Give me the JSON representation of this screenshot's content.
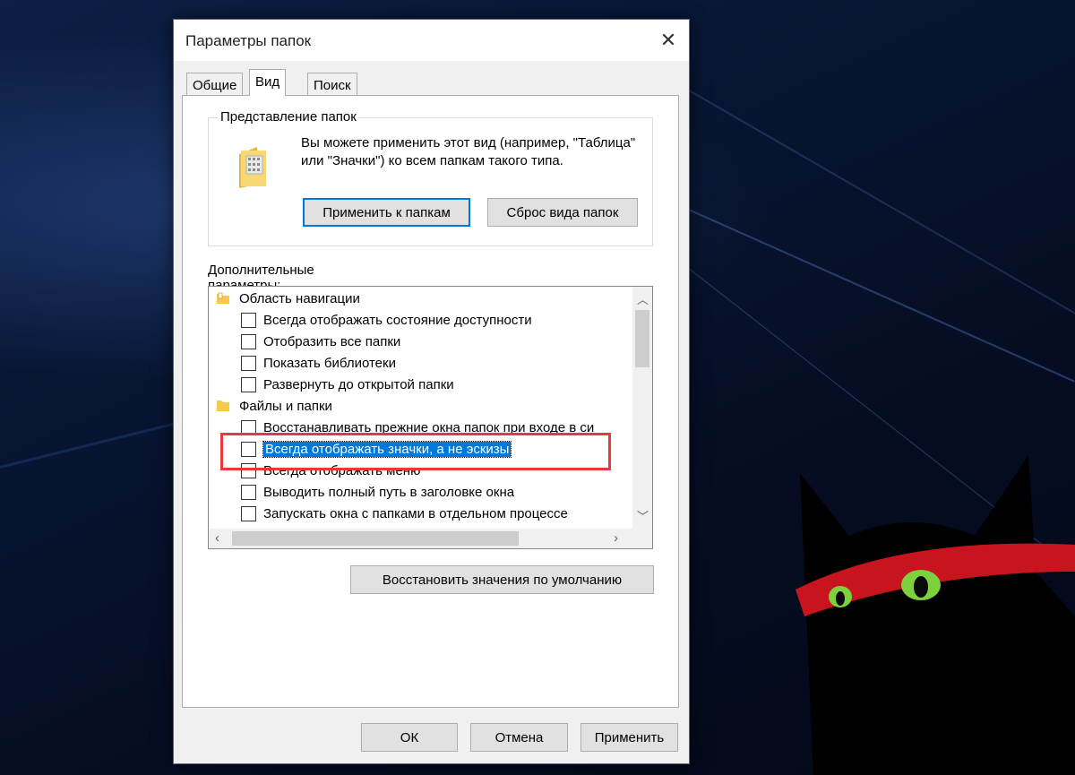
{
  "dialog": {
    "title": "Параметры папок",
    "close_glyph": "✕"
  },
  "tabs": [
    {
      "label": "Общие"
    },
    {
      "label": "Вид"
    },
    {
      "label": "Поиск"
    }
  ],
  "folder_views": {
    "group_title": "Представление папок",
    "description": "Вы можете применить этот вид (например, \"Таблица\" или \"Значки\") ко всем папкам такого типа.",
    "apply_button": "Применить к папкам",
    "reset_button": "Сброс вида папок"
  },
  "advanced": {
    "label": "Дополнительные параметры:",
    "rows": [
      {
        "type": "category",
        "icon": "navigation-pane-icon",
        "label": "Область навигации"
      },
      {
        "type": "checkbox",
        "checked": false,
        "label": "Всегда отображать состояние доступности"
      },
      {
        "type": "checkbox",
        "checked": false,
        "label": "Отобразить все папки"
      },
      {
        "type": "checkbox",
        "checked": false,
        "label": "Показать библиотеки"
      },
      {
        "type": "checkbox",
        "checked": false,
        "label": "Развернуть до открытой папки"
      },
      {
        "type": "category",
        "icon": "folder-icon",
        "label": "Файлы и папки"
      },
      {
        "type": "checkbox",
        "checked": false,
        "label": "Восстанавливать прежние окна папок при входе в си"
      },
      {
        "type": "checkbox",
        "checked": false,
        "selected": true,
        "label": "Всегда отображать значки, а не эскизы"
      },
      {
        "type": "checkbox",
        "checked": false,
        "label": "Всегда отображать меню"
      },
      {
        "type": "checkbox",
        "checked": false,
        "label": "Выводить полный путь в заголовке окна"
      },
      {
        "type": "checkbox",
        "checked": false,
        "label": "Запускать окна с папками в отдельном процессе"
      }
    ]
  },
  "restore_button": "Восстановить значения по умолчанию",
  "footer": {
    "ok": "ОК",
    "cancel": "Отмена",
    "apply": "Применить"
  },
  "colors": {
    "accent": "#0078d7",
    "highlight_box": "#e8383d"
  }
}
